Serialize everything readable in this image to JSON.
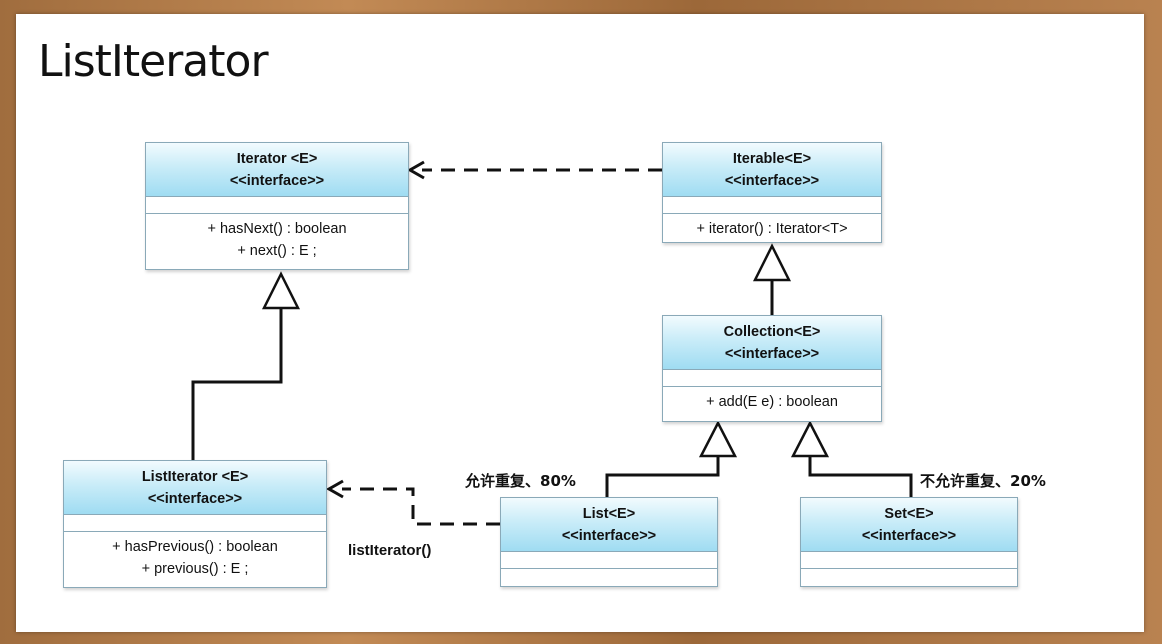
{
  "title": "ListIterator",
  "classes": {
    "iterator": {
      "name": "Iterator <E>",
      "stereotype": "<<interface>>",
      "ops": [
        "+ hasNext() : boolean",
        "+ next() : E ;"
      ]
    },
    "iterable": {
      "name": "Iterable<E>",
      "stereotype": "<<interface>>",
      "ops": [
        "+ iterator() : Iterator<T>"
      ]
    },
    "collection": {
      "name": "Collection<E>",
      "stereotype": "<<interface>>",
      "ops": [
        "+ add(E e) : boolean"
      ]
    },
    "listiterator": {
      "name": "ListIterator <E>",
      "stereotype": "<<interface>>",
      "ops": [
        "+ hasPrevious() : boolean",
        "+ previous() : E ;"
      ]
    },
    "list": {
      "name": "List<E>",
      "stereotype": "<<interface>>",
      "ops": []
    },
    "set": {
      "name": "Set<E>",
      "stereotype": "<<interface>>",
      "ops": []
    }
  },
  "labels": {
    "list_branch": "允许重复、80%",
    "set_branch": "不允许重复、20%",
    "list_iterator_method": "listIterator()"
  },
  "colors": {
    "header_top": "#f2fbfe",
    "header_bottom": "#9fdcf2",
    "border": "#8aa9b8",
    "line": "#111111"
  }
}
